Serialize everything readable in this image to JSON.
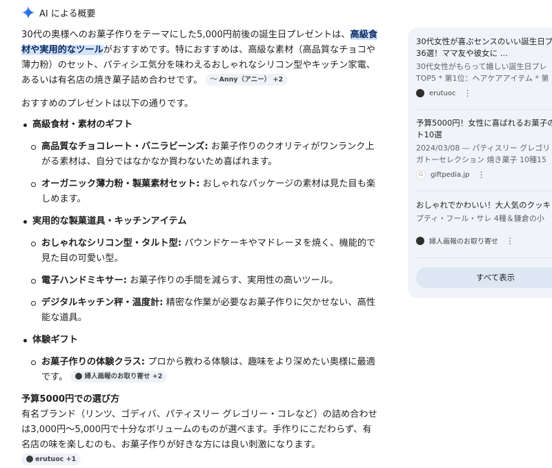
{
  "header": {
    "title": "AI による概要"
  },
  "intro": {
    "part1": "30代の奥様へのお菓子作りをテーマにした5,000円前後の誕生日プレゼントは、",
    "highlight": "高級食材や実用的なツール",
    "part2": "がおすすめです。特におすすめは、高級な素材（高品質なチョコや薄力粉）のセット、パティシエ気分を味わえるおしゃれなシリコン型やキッチン家電、あるいは有名店の焼き菓子詰め合わせです。",
    "chip": "Anny（アニー） +2"
  },
  "lead": "おすすめのプレゼントは以下の通りです。",
  "categories": [
    {
      "title": "高級食材・素材のギフト",
      "items": [
        {
          "name": "高品質なチョコレート・バニラビーンズ:",
          "desc": " お菓子作りのクオリティがワンランク上がる素材は、自分ではなかなか買わないため喜ばれます。"
        },
        {
          "name": "オーガニック薄力粉・製菓素材セット:",
          "desc": " おしゃれなパッケージの素材は見た目も楽しめます。"
        }
      ]
    },
    {
      "title": "実用的な製菓道具・キッチンアイテム",
      "items": [
        {
          "name": "おしゃれなシリコン型・タルト型:",
          "desc": " パウンドケーキやマドレーヌを焼く、機能的で見た目の可愛い型。"
        },
        {
          "name": "電子ハンドミキサー:",
          "desc": " お菓子作りの手間を減らす、実用性の高いツール。"
        },
        {
          "name": "デジタルキッチン秤・温度計:",
          "desc": " 精密な作業が必要なお菓子作りに欠かせない、高性能な道具。"
        }
      ]
    },
    {
      "title": "体験ギフト",
      "items": [
        {
          "name": "お菓子作りの体験クラス:",
          "desc": " プロから教わる体験は、趣味をより深めたい奥様に最適です。",
          "chip": "婦人画報のお取り寄せ +2"
        }
      ]
    }
  ],
  "budget": {
    "title": "予算5000円での選び方",
    "text": "有名ブランド（リンツ、ゴディバ、パティスリー グレゴリー・コレなど）の詰め合わせは3,000円〜5,000円で十分なボリュームのものが選べます。手作りにこだわらず、有名店の味を楽しむのも、お菓子作りが好きな方には良い刺激になります。",
    "chip": "erutuoc +1"
  },
  "sources": [
    {
      "title1": "30代女性が喜ぶセンスのいい誕生日プ",
      "title2": "36選！ママ友や彼女に ...",
      "snippet": "30代女性がもらって嬉しい誕生日プレ",
      "snippet2": "TOP5 * 第1位：ヘアケアアイテム * 第",
      "site": "erutuoc"
    },
    {
      "title1": "予算5000円！女性に喜ばれるお菓子の",
      "title2": "ト10選",
      "snippet": "2024/03/08 — パティスリー グレゴリ",
      "snippet2": "ガトーセレクション 焼き菓子 10種15",
      "site": "giftpedia.jp"
    },
    {
      "title1": "おしゃれでかわいい！大人気のクッキ",
      "title2": "",
      "snippet": "プティ・フール・サレ 4種＆鎌倉の小",
      "snippet2": "",
      "site": "婦人画報のお取り寄せ"
    }
  ],
  "show_all": "すべて表示"
}
